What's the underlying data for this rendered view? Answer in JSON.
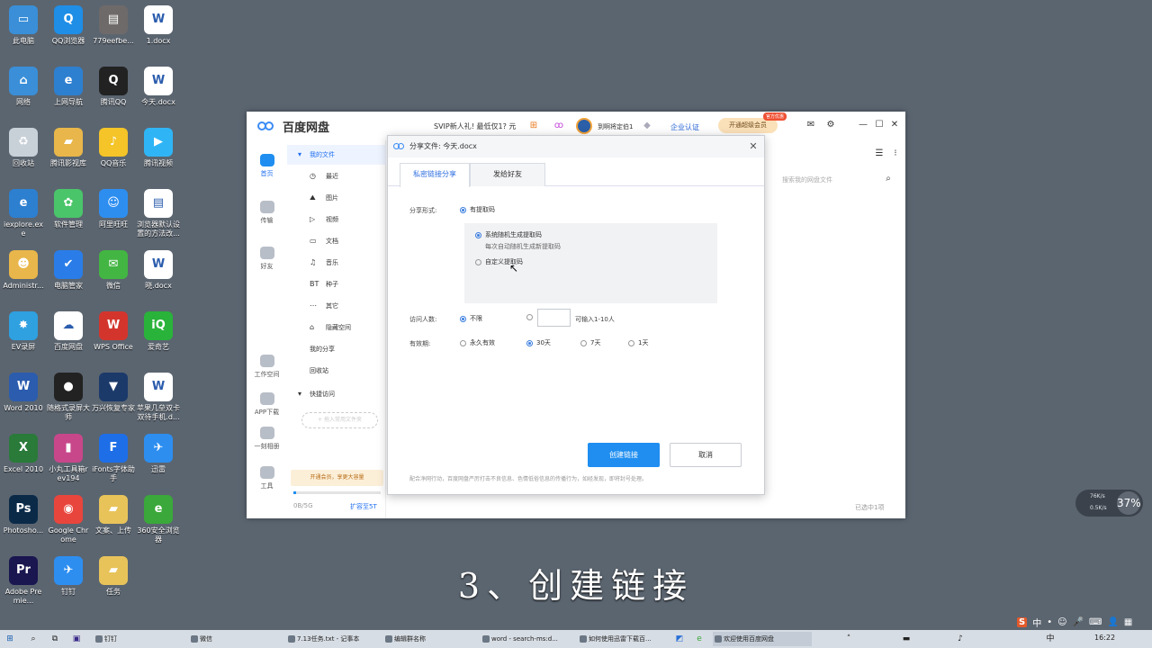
{
  "desktop": {
    "icons": [
      {
        "label": "此电脑",
        "name": "this-pc-icon",
        "color": "#3a8fd8",
        "glyph": "▭"
      },
      {
        "label": "QQ浏览器",
        "name": "qq-browser-icon",
        "color": "#1e8ee6",
        "glyph": "Q"
      },
      {
        "label": "779eefbe...",
        "name": "image-file-icon",
        "color": "#6f6a6a",
        "glyph": "▤"
      },
      {
        "label": "1.docx",
        "name": "word-doc-icon",
        "color": "#ffffff",
        "glyph": "W"
      },
      {
        "label": "网络",
        "name": "network-icon",
        "color": "#3a8fd8",
        "glyph": "⌂"
      },
      {
        "label": "上网导航",
        "name": "ie-nav-icon",
        "color": "#2d7fd0",
        "glyph": "e"
      },
      {
        "label": "腾讯QQ",
        "name": "tencent-qq-icon",
        "color": "#222222",
        "glyph": "Q"
      },
      {
        "label": "今天.docx",
        "name": "word-doc-icon",
        "color": "#ffffff",
        "glyph": "W"
      },
      {
        "label": "回收站",
        "name": "recycle-bin-icon",
        "color": "#c8d0d8",
        "glyph": "♻"
      },
      {
        "label": "腾讯影视库",
        "name": "folder-icon",
        "color": "#e8b64a",
        "glyph": "▰"
      },
      {
        "label": "QQ音乐",
        "name": "qq-music-icon",
        "color": "#f4c428",
        "glyph": "♪"
      },
      {
        "label": "腾讯视频",
        "name": "tencent-video-icon",
        "color": "#2fb5f5",
        "glyph": "▶"
      },
      {
        "label": "iexplore.exe",
        "name": "ie-icon",
        "color": "#2d7fd0",
        "glyph": "e"
      },
      {
        "label": "软件管理",
        "name": "software-manager-icon",
        "color": "#4ac56a",
        "glyph": "✿"
      },
      {
        "label": "阿里旺旺",
        "name": "aliwangwang-icon",
        "color": "#2d8ef0",
        "glyph": "☺"
      },
      {
        "label": "浏览器默认设置的方法改...",
        "name": "text-file-icon",
        "color": "#ffffff",
        "glyph": "▤"
      },
      {
        "label": "Administr...",
        "name": "user-folder-icon",
        "color": "#e8b64a",
        "glyph": "☻"
      },
      {
        "label": "电脑管家",
        "name": "pc-manager-icon",
        "color": "#2a7de8",
        "glyph": "✔"
      },
      {
        "label": "微信",
        "name": "wechat-icon",
        "color": "#43b543",
        "glyph": "✉"
      },
      {
        "label": "晓.docx",
        "name": "word-doc-icon",
        "color": "#ffffff",
        "glyph": "W"
      },
      {
        "label": "EV录屏",
        "name": "ev-recorder-icon",
        "color": "#2fa0e0",
        "glyph": "✸"
      },
      {
        "label": "百度网盘",
        "name": "baidu-netdisk-icon",
        "color": "#ffffff",
        "glyph": "☁"
      },
      {
        "label": "WPS Office",
        "name": "wps-icon",
        "color": "#d3352d",
        "glyph": "W"
      },
      {
        "label": "爱奇艺",
        "name": "iqiyi-icon",
        "color": "#29b33a",
        "glyph": "iQ"
      },
      {
        "label": "Word 2010",
        "name": "word-2010-icon",
        "color": "#2b5cad",
        "glyph": "W"
      },
      {
        "label": "随格式录屏大师",
        "name": "screen-recorder-icon",
        "color": "#222222",
        "glyph": "●"
      },
      {
        "label": "万兴恢复专家",
        "name": "recovery-icon",
        "color": "#1b3a6a",
        "glyph": "▼"
      },
      {
        "label": "苹果几垒双卡双待手机.d...",
        "name": "word-doc-icon",
        "color": "#ffffff",
        "glyph": "W"
      },
      {
        "label": "Excel 2010",
        "name": "excel-icon",
        "color": "#2a7a3a",
        "glyph": "X"
      },
      {
        "label": "小丸工具箱rev194",
        "name": "toolbox-icon",
        "color": "#c8478a",
        "glyph": "▮"
      },
      {
        "label": "iFonts字体助手",
        "name": "ifonts-icon",
        "color": "#1e6ee8",
        "glyph": "F"
      },
      {
        "label": "迅雷",
        "name": "xunlei-icon",
        "color": "#2d8ef0",
        "glyph": "✈"
      },
      {
        "label": "Photosho...",
        "name": "photoshop-icon",
        "color": "#0a2a48",
        "glyph": "Ps"
      },
      {
        "label": "Google Chrome",
        "name": "chrome-icon",
        "color": "#e8453c",
        "glyph": "◉"
      },
      {
        "label": "文案、上传",
        "name": "folder-icon",
        "color": "#e8c35a",
        "glyph": "▰"
      },
      {
        "label": "360安全浏览器",
        "name": "360-browser-icon",
        "color": "#3aa83a",
        "glyph": "e"
      },
      {
        "label": "Adobe Premie...",
        "name": "premiere-icon",
        "color": "#1a1650",
        "glyph": "Pr"
      },
      {
        "label": "钉钉",
        "name": "dingtalk-icon",
        "color": "#2d8ef0",
        "glyph": "✈"
      },
      {
        "label": "任务",
        "name": "folder-icon",
        "color": "#e8c35a",
        "glyph": "▰"
      }
    ]
  },
  "app": {
    "title": "百度网盘",
    "svip_text": "SVIP新人礼! 最低仅1? 元",
    "username": "到啊将定伯1",
    "enterprise": "企业认证",
    "vip_button": "开通超级会员",
    "vip_badge": "官方优惠",
    "left_nav": [
      {
        "label": "首页",
        "name": "nav-home"
      },
      {
        "label": "传输",
        "name": "nav-transfer"
      },
      {
        "label": "好友",
        "name": "nav-friends"
      },
      {
        "label": "工作空间",
        "name": "nav-workspace"
      },
      {
        "label": "APP下载",
        "name": "nav-app-download"
      },
      {
        "label": "一刻相册",
        "name": "nav-album"
      },
      {
        "label": "工具",
        "name": "nav-tools"
      }
    ],
    "files_menu": [
      {
        "label": "我的文件",
        "glyph": "▾",
        "section": true,
        "active": true,
        "name": "folder-my-files"
      },
      {
        "label": "最近",
        "glyph": "◷",
        "name": "folder-recent"
      },
      {
        "label": "图片",
        "glyph": "⛰",
        "name": "folder-images"
      },
      {
        "label": "视频",
        "glyph": "▷",
        "name": "folder-videos"
      },
      {
        "label": "文档",
        "glyph": "▭",
        "name": "folder-docs"
      },
      {
        "label": "音乐",
        "glyph": "♫",
        "name": "folder-music"
      },
      {
        "label": "种子",
        "glyph": "BT",
        "name": "folder-torrents"
      },
      {
        "label": "其它",
        "glyph": "⋯",
        "name": "folder-other"
      },
      {
        "label": "隐藏空间",
        "glyph": "⌂",
        "name": "folder-hidden"
      },
      {
        "label": "我的分享",
        "glyph": "",
        "section": true,
        "name": "folder-my-shares"
      },
      {
        "label": "回收站",
        "glyph": "",
        "section": true,
        "name": "folder-recycle"
      },
      {
        "label": "快捷访问",
        "glyph": "▾",
        "section": true,
        "name": "folder-quick-access"
      }
    ],
    "add_quick": "+ 拖入常用文件夹",
    "vip_bar": "开通会员，享更大容量",
    "storage_used": "0B/5G",
    "storage_fraction": 0.03,
    "expand_link": "扩容至5T",
    "search_placeholder": "搜索我的网盘文件",
    "selected_count": "已选中1项"
  },
  "dialog": {
    "title": "分享文件: 今天.docx",
    "tabs": [
      "私密链接分享",
      "发给好友"
    ],
    "share_form_label": "分享形式:",
    "share_form_option": "有提取码",
    "code_opt1": "系统随机生成提取码",
    "code_opt1_note": "每次自动随机生成新提取码",
    "code_opt2": "自定义提取码",
    "visitors_label": "访问人数:",
    "visitors_unlimited": "不限",
    "visitors_hint": "可输入1-10人",
    "validity_label": "有效期:",
    "validity_options": [
      "永久有效",
      "30天",
      "7天",
      "1天"
    ],
    "create_button": "创建链接",
    "cancel_button": "取消",
    "footer": "配合净网行动，百度网盘严厉打击不良信息、色情低俗信息的传播行为，如经发现，即将封号处理。"
  },
  "caption": "3、创建链接",
  "netwidget": {
    "up": "76K/s",
    "down": "0.5K/s",
    "percent": "37%"
  },
  "taskbar": {
    "buttons": [
      "钉钉",
      "微信",
      "7.13任务.txt - 记事本",
      "编辑群名称",
      "word - search-ms:d...",
      "如何使用迅雷下载百...",
      "欢迎使用百度网盘"
    ],
    "time": "16:22"
  },
  "tray": {
    "ime": "中",
    "items": [
      "•",
      "☺",
      "🎤",
      "⌨",
      "👤",
      "▦"
    ]
  }
}
